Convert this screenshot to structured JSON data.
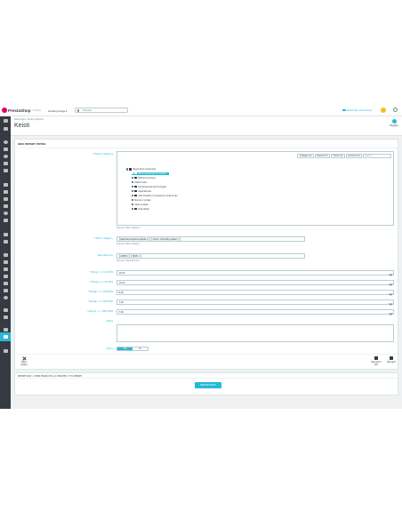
{
  "header": {
    "logo_text": "PrestaShop",
    "version": "1.7.6.4",
    "quick_access": "Greita prieiga ▾",
    "search_placeholder": "Paieška",
    "shop_link": "Peržiūrėti parduotuvę"
  },
  "breadcrumb": "Kata-logas  /  Prekių peržiūra",
  "page_title": "Keisti",
  "help_label": "Pagalba",
  "panel": {
    "title": "ADD IMPORT EXTRA",
    "fields": {
      "parent_category_label": "Parent category",
      "other_category_label": "Other category",
      "manufacturer_label": "Manufacturer",
      "margin1_label": "Margin >= 10 EUR",
      "margin2_label": "Margin >= 50 EUR",
      "margin3_label": "Margin >= 100 EUR",
      "margin4_label": "Margin >= 500 EUR",
      "margin5_label": "Margin >= 1000 EUR",
      "notes_label": "Notes",
      "active_label": "Active"
    },
    "tree_toolbar": [
      "Collapse All",
      "Expand All",
      "Check All",
      "Uncheck All"
    ],
    "tree_search_placeholder": "search...",
    "tree": [
      "Pagrindinis (Lietuviai)",
      "Rekomenduojamos prekės",
      "Buitinė technika",
      "Elektronika",
      "Kompiuterinė technologija",
      "Apšvietimas",
      "Automobiliai ir transporto priemonės",
      "Namai ir sodas",
      "Vaikų prekės",
      "Kosmetika"
    ],
    "parent_hint": "Choose 1 New category",
    "other_tags": [
      "Rekomenduojamos prekės",
      "Auto ir motociklų prekės"
    ],
    "other_hint": "Choose 1 New category",
    "manufacturer_tags": [
      "ACME",
      "MRE"
    ],
    "manufacturer_hint": "Choose 1 Manufacturer",
    "margins": [
      "10.00",
      "10.00",
      "8.00",
      "7.00",
      "7.00"
    ],
    "toggle_on": "YES",
    "toggle_off": "NO"
  },
  "footer_buttons": {
    "back": "Atgal į sąrašą",
    "save_stay": "Išsaugoti ir likti",
    "save": "Išsaugoti"
  },
  "import_panel": {
    "title": "IMPORT NOW - 0 NEW PRODUCTS & 0 UPDATED / 0 TO IMPORT",
    "button": "IMPORT NOW"
  },
  "colors": {
    "accent": "#25b9d7",
    "sidebar": "#363a41",
    "background": "#eff1f2",
    "logo": "#df0067"
  }
}
